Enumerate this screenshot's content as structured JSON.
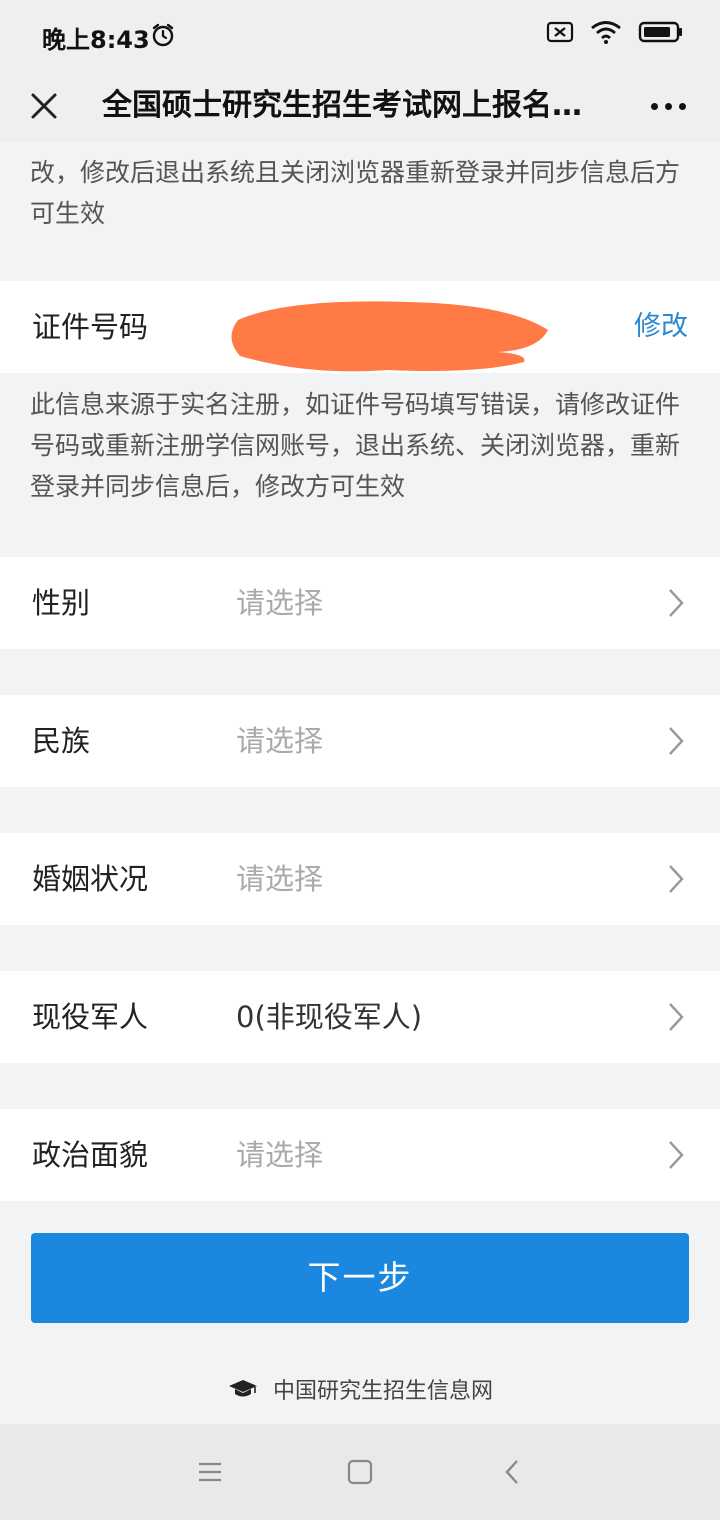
{
  "status": {
    "time": "晚上8:43"
  },
  "header": {
    "title": "全国硕士研究生招生考试网上报名…"
  },
  "notes": {
    "top": "改，修改后退出系统且关闭浏览器重新登录并同步信息后方可生效",
    "id_number": "此信息来源于实名注册，如证件号码填写错误，请修改证件号码或重新注册学信网账号，退出系统、关闭浏览器，重新登录并同步信息后，修改方可生效"
  },
  "id_row": {
    "label": "证件号码",
    "edit_label": "修改"
  },
  "fields": [
    {
      "label": "性别",
      "value": "请选择",
      "filled": false
    },
    {
      "label": "民族",
      "value": "请选择",
      "filled": false
    },
    {
      "label": "婚姻状况",
      "value": "请选择",
      "filled": false
    },
    {
      "label": "现役军人",
      "value": "0(非现役军人)",
      "filled": true
    },
    {
      "label": "政治面貌",
      "value": "请选择",
      "filled": false
    }
  ],
  "actions": {
    "next_label": "下一步"
  },
  "footer": {
    "text": "中国研究生招生信息网"
  },
  "colors": {
    "accent": "#1c87df",
    "link": "#2b89d2",
    "redaction": "#ff7a45"
  }
}
